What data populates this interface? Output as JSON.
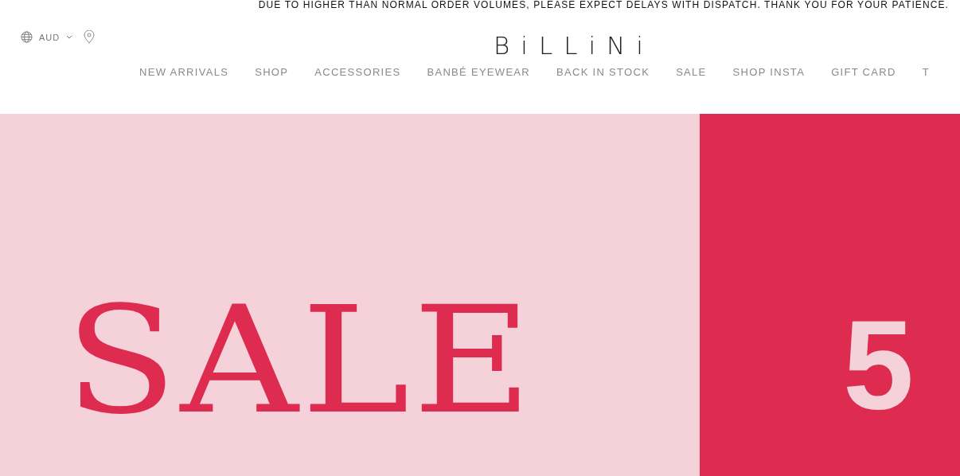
{
  "announcement": "DUE TO HIGHER THAN NORMAL ORDER VOLUMES, PLEASE EXPECT DELAYS WITH DISPATCH. THANK YOU FOR YOUR PATIENCE.",
  "currency": "AUD",
  "logo": "BiLLiNi",
  "nav": [
    {
      "label": "NEW ARRIVALS"
    },
    {
      "label": "SHOP"
    },
    {
      "label": "ACCESSORIES"
    },
    {
      "label": "BANBÉ EYEWEAR"
    },
    {
      "label": "BACK IN STOCK"
    },
    {
      "label": "SALE"
    },
    {
      "label": "SHOP INSTA"
    },
    {
      "label": "GIFT CARD"
    },
    {
      "label": "T"
    }
  ],
  "banner": {
    "headline": "SALE",
    "figure": "5"
  }
}
